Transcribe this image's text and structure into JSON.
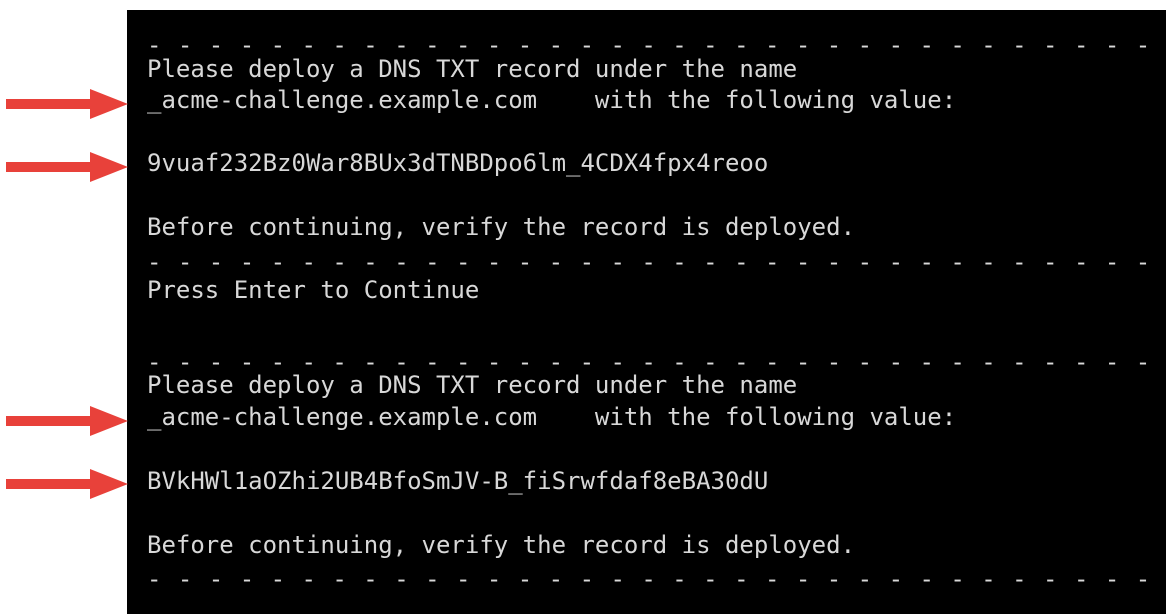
{
  "colors": {
    "terminal_background": "#000000",
    "terminal_text": "#d8d8d8",
    "arrow": "#e8413a",
    "page_background": "#ffffff"
  },
  "icons": {
    "arrow": "arrow-right-icon"
  },
  "separator": "- - - - - - - - - - - - - - - - - - - - - - - - - - - - - - - - - - - - - - - - -",
  "blocks": [
    {
      "instruction": "Please deploy a DNS TXT record under the name",
      "record_name_line": "_acme-challenge.example.com    with the following value:",
      "value": "9vuaf232Bz0War8BUx3dTNBDpo6lm_4CDX4fpx4reoo",
      "verify": "Before continuing, verify the record is deployed."
    },
    {
      "instruction": "Please deploy a DNS TXT record under the name",
      "record_name_line": "_acme-challenge.example.com    with the following value:",
      "value": "BVkHWl1aOZhi2UB4BfoSmJV-B_fiSrwfdaf8eBA30dU",
      "verify": "Before continuing, verify the record is deployed."
    }
  ],
  "prompt": "Press Enter to Continue"
}
